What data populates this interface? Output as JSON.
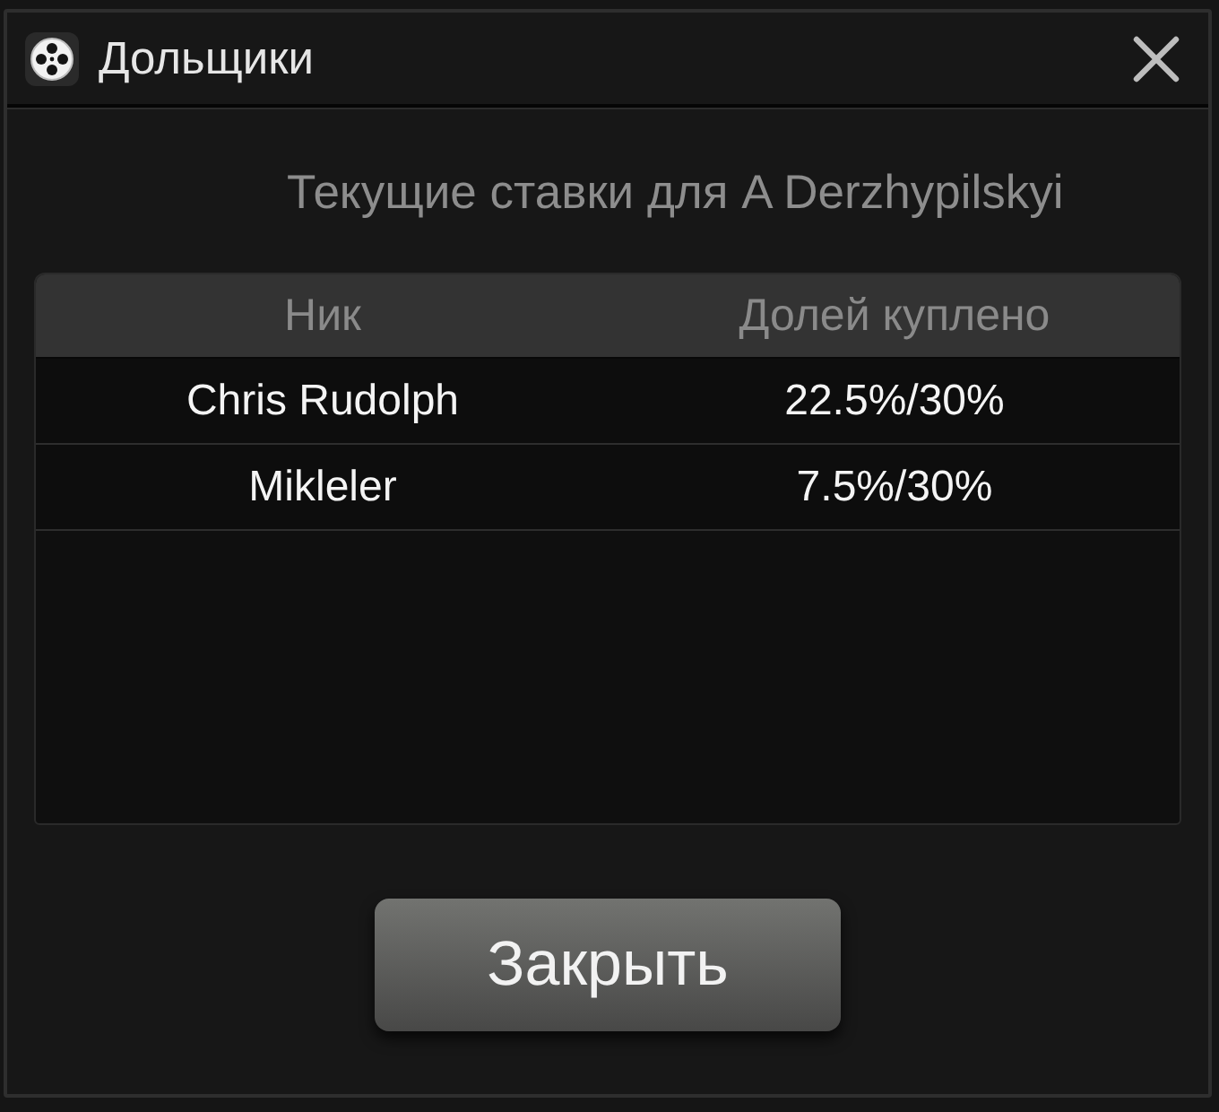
{
  "window": {
    "title": "Дольщики"
  },
  "subtitle": "Текущие ставки для A Derzhypilskyi",
  "table": {
    "columns": [
      "Ник",
      "Долей куплено"
    ],
    "rows": [
      [
        "Chris Rudolph",
        "22.5%/30%"
      ],
      [
        "Mikleler",
        "7.5%/30%"
      ]
    ]
  },
  "buttons": [
    {
      "label": "Закрыть"
    }
  ]
}
